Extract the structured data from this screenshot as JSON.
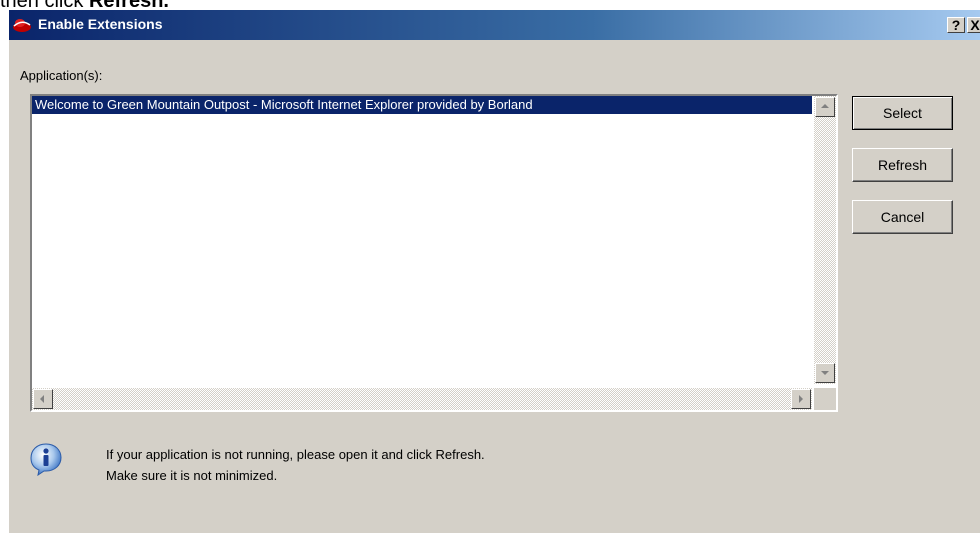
{
  "caption_fragment": {
    "prefix": "then click ",
    "bold": "Refresh."
  },
  "window": {
    "title": "Enable Extensions",
    "help_label": "?",
    "close_label": "X"
  },
  "applications": {
    "label": "Application(s):",
    "items": [
      "Welcome to Green Mountain Outpost - Microsoft Internet Explorer provided by Borland"
    ],
    "selected_index": 0
  },
  "buttons": {
    "select": "Select",
    "refresh": "Refresh",
    "cancel": "Cancel"
  },
  "info": {
    "icon": "info-icon",
    "line1": "If your application is not running, please open it and click Refresh.",
    "line2": "Make sure it is not minimized."
  },
  "colors": {
    "title_gradient_start": "#0a246a",
    "title_gradient_end": "#a6caf0",
    "dialog_bg": "#d4d0c8",
    "selection": "#0a246a"
  }
}
